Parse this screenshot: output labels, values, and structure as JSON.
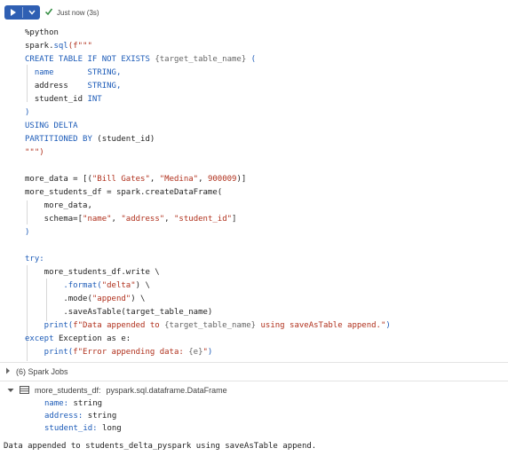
{
  "toolbar": {
    "run_icon": "play-icon",
    "menu_icon": "chevron-down-icon",
    "status_icon": "check-icon",
    "status_text": "Just now (3s)",
    "colors": {
      "run_button": "#2f5fb3",
      "check": "#2e8b3d"
    }
  },
  "code": {
    "l1": "%python",
    "l2a": "spark.",
    "l2b": "sql",
    "l2c": "(f\"\"\"",
    "l3a": "CREATE TABLE IF NOT EXISTS ",
    "l3b": "{target_table_name}",
    "l3c": " (",
    "l4a": "  name       ",
    "l4b": "STRING,",
    "l5a": "  address    ",
    "l5b": "STRING,",
    "l6a": "  student_id ",
    "l6b": "INT",
    "l7": ")",
    "l8": "USING DELTA",
    "l9a": "PARTITIONED BY ",
    "l9b": "(student_id)",
    "l10": "\"\"\")",
    "l11a": "more_data = [(",
    "l11b": "\"Bill Gates\"",
    "l11c": ", ",
    "l11d": "\"Medina\"",
    "l11e": ", ",
    "l11f": "900009",
    "l11g": ")]",
    "l12": "more_students_df = spark.createDataFrame(",
    "l13": "    more_data,",
    "l14a": "    schema=[",
    "l14b": "\"name\"",
    "l14c": ", ",
    "l14d": "\"address\"",
    "l14e": ", ",
    "l14f": "\"student_id\"",
    "l14g": "]",
    "l15": ")",
    "l16": "try:",
    "l17": "    more_students_df.write \\",
    "l18a": "        .format(",
    "l18b": "\"delta\"",
    "l18c": ") \\",
    "l19a": "        .mode(",
    "l19b": "\"append\"",
    "l19c": ") \\",
    "l20": "        .saveAsTable(target_table_name)",
    "l21a": "    print(",
    "l21b": "f\"Data appended to ",
    "l21c": "{target_table_name}",
    "l21d": " using saveAsTable append.\"",
    "l21e": ")",
    "l22a": "except ",
    "l22b": "Exception",
    "l22c": " as e:",
    "l23a": "    print(",
    "l23b": "f\"Error appending data: ",
    "l23c": "{e}",
    "l23d": "\"",
    "l23e": ")"
  },
  "spark_jobs": {
    "label": "(6) Spark Jobs"
  },
  "schema": {
    "var": "more_students_df:",
    "type": "pyspark.sql.dataframe.DataFrame",
    "fields": [
      {
        "name": "name:",
        "type": "string"
      },
      {
        "name": "address:",
        "type": "string"
      },
      {
        "name": "student_id:",
        "type": "long"
      }
    ]
  },
  "output_text": "Data appended to students_delta_pyspark using saveAsTable append."
}
